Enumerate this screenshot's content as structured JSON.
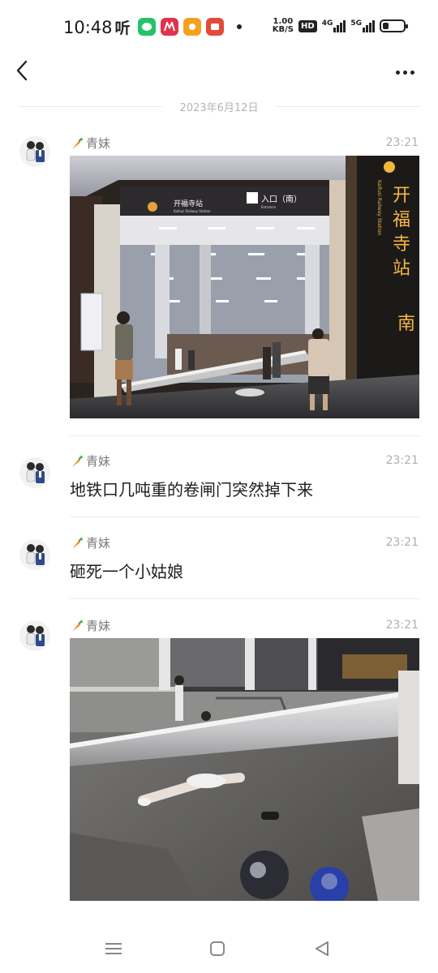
{
  "status_bar": {
    "time": "10:48",
    "left_icons": [
      "ting-icon",
      "wechat-icon",
      "metro-icon",
      "app-icon",
      "app-red-icon"
    ],
    "ting_label": "听",
    "net_speed_value": "1.00",
    "net_speed_unit": "KB/S",
    "hd_label": "HD",
    "sig1_label": "4G",
    "sig2_label": "5G",
    "battery_level": 0.3
  },
  "nav": {
    "back_icon": "chevron-left-icon",
    "more_icon": "more-icon"
  },
  "date_separator": "2023年6月12日",
  "messages": [
    {
      "sender": "青妹",
      "time": "23:21",
      "type": "image",
      "image_desc": "开福寺站"
    },
    {
      "sender": "青妹",
      "time": "23:21",
      "type": "text",
      "text": "地铁口几吨重的卷闸门突然掉下来"
    },
    {
      "sender": "青妹",
      "time": "23:21",
      "type": "text",
      "text": "砸死一个小姑娘"
    },
    {
      "sender": "青妹",
      "time": "23:21",
      "type": "image"
    }
  ],
  "photo1": {
    "sign_left": "开福寺站",
    "sign_left_en": "Kaifusi Railway Station",
    "sign_entrance": "入口（南）",
    "sign_entrance_en": "Entrance",
    "pillar_text": "开福寺站",
    "pillar_en": "Kaifusi Railway Station",
    "pillar_south": "南"
  },
  "colors": {
    "accent_orange": "#f08a24",
    "text_gray": "#7a7a7a",
    "time_gray": "#b0b0b0"
  },
  "system_nav": [
    "menu-icon",
    "home-icon",
    "back-triangle-icon"
  ]
}
